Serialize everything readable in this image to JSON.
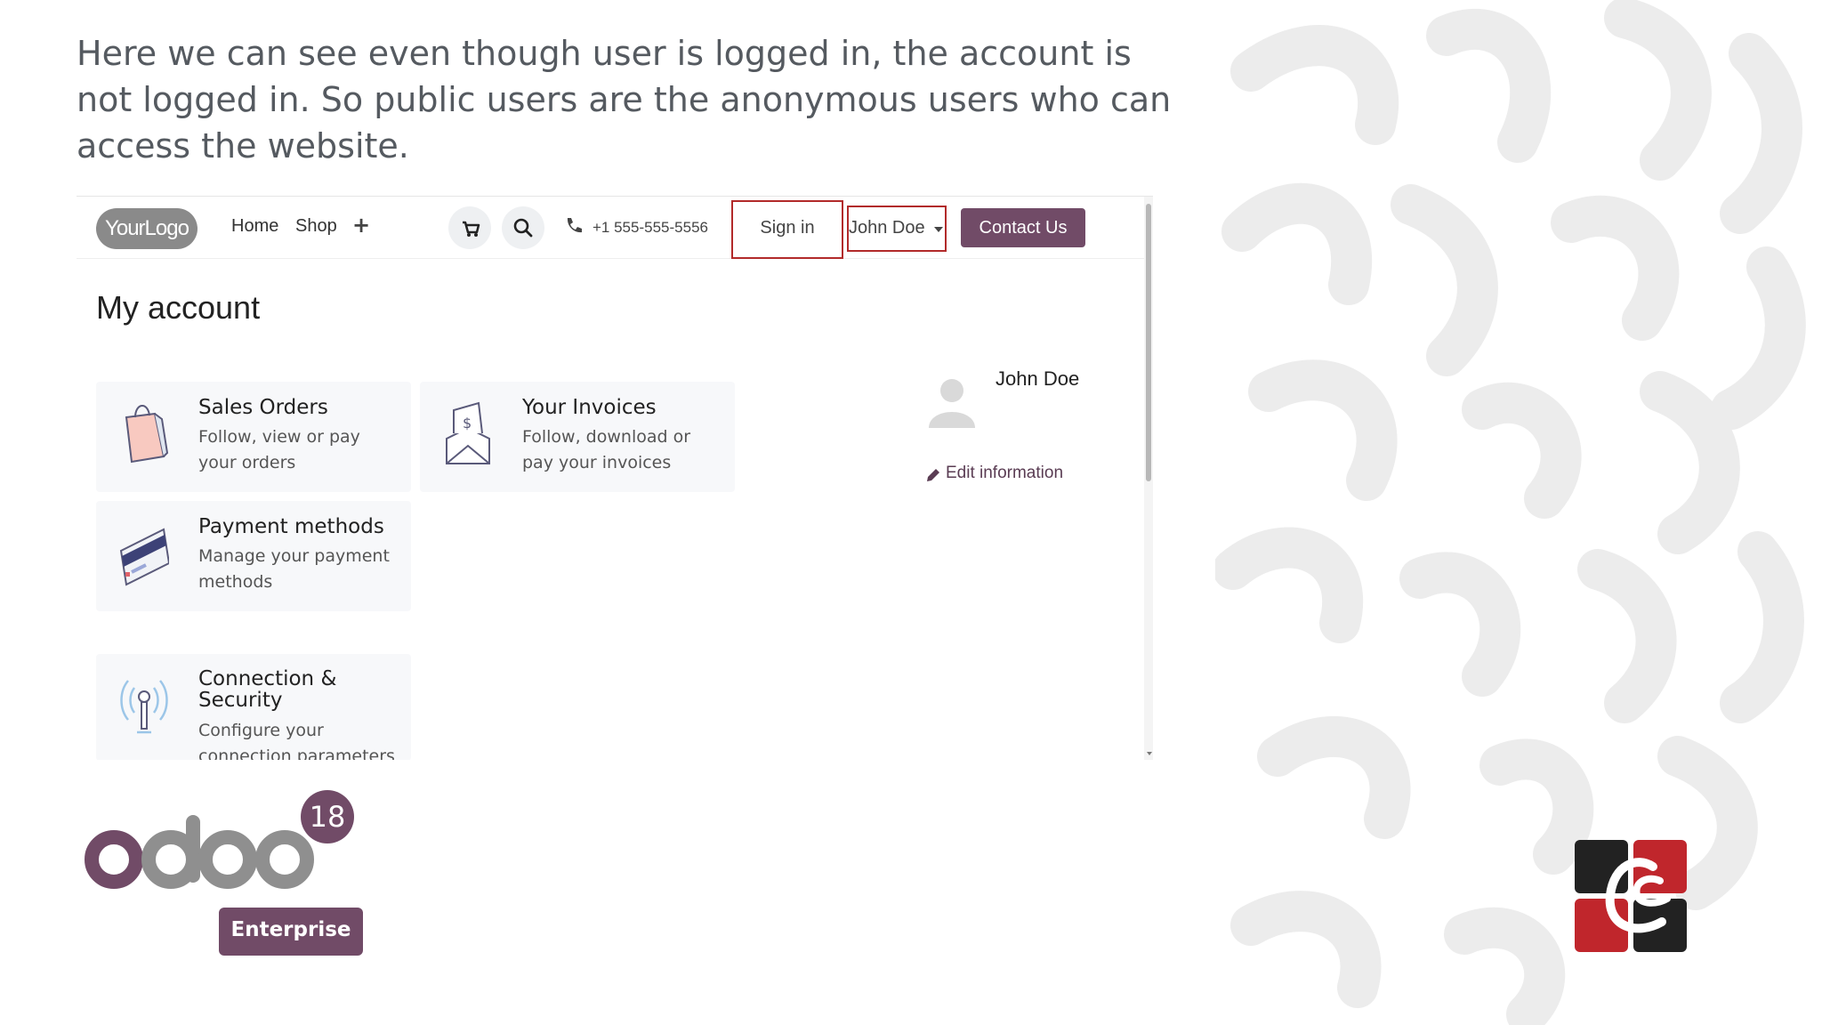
{
  "caption": "Here we can see even though user is logged in, the account is not logged in. So public users are the anonymous users who can access the website.",
  "navbar": {
    "logo_text": "YourLogo",
    "links": [
      "Home",
      "Shop"
    ],
    "phone": "+1 555-555-5556",
    "sign_in": "Sign in",
    "user": "John Doe",
    "contact": "Contact Us"
  },
  "page": {
    "title": "My account",
    "cards": [
      {
        "title": "Sales Orders",
        "desc": "Follow, view or pay your orders",
        "icon": "shopping-bag-icon"
      },
      {
        "title": "Your Invoices",
        "desc": "Follow, download or pay your invoices",
        "icon": "invoice-envelope-icon"
      },
      {
        "title": "Payment methods",
        "desc": "Manage your payment methods",
        "icon": "credit-card-icon"
      },
      {
        "title": "Connection & Security",
        "desc": "Configure your connection parameters",
        "icon": "antenna-icon"
      }
    ],
    "profile": {
      "name": "John Doe",
      "edit": "Edit information"
    }
  },
  "branding": {
    "odoo_version": "18",
    "edition": "Enterprise",
    "accent": "#714b67",
    "highlight": "#b22a2a"
  }
}
